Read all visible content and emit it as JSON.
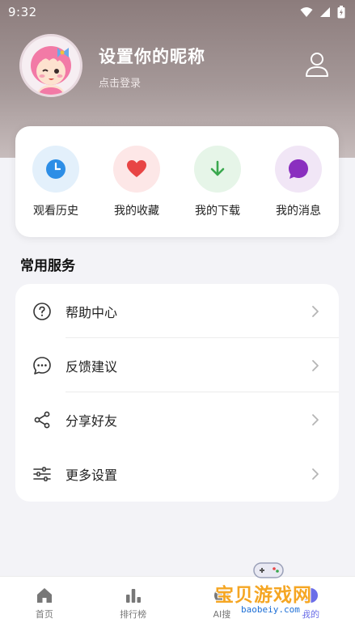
{
  "status_bar": {
    "time": "9:32"
  },
  "profile": {
    "nickname": "设置你的昵称",
    "login_hint": "点击登录"
  },
  "quick_actions": [
    {
      "label": "观看历史",
      "icon": "clock-icon",
      "bg": "#e3f0fb",
      "color": "#2d8ee6"
    },
    {
      "label": "我的收藏",
      "icon": "heart-icon",
      "bg": "#fde7e7",
      "color": "#e84545"
    },
    {
      "label": "我的下载",
      "icon": "download-icon",
      "bg": "#e6f5e8",
      "color": "#3aa84e"
    },
    {
      "label": "我的消息",
      "icon": "message-icon",
      "bg": "#f1e6f6",
      "color": "#8a2fbf"
    }
  ],
  "services": {
    "title": "常用服务",
    "items": [
      {
        "label": "帮助中心",
        "icon": "help-icon"
      },
      {
        "label": "反馈建议",
        "icon": "feedback-icon"
      },
      {
        "label": "分享好友",
        "icon": "share-icon"
      },
      {
        "label": "更多设置",
        "icon": "settings-sliders-icon"
      }
    ]
  },
  "tab_bar": {
    "items": [
      {
        "label": "首页",
        "icon": "home-icon"
      },
      {
        "label": "排行榜",
        "icon": "ranking-icon"
      },
      {
        "label": "AI搜",
        "icon": "ai-search-icon"
      },
      {
        "label": "我的",
        "icon": "profile-icon",
        "active": true
      }
    ]
  },
  "watermark": {
    "text": "宝贝游戏网",
    "url": "baobeiy.com"
  }
}
